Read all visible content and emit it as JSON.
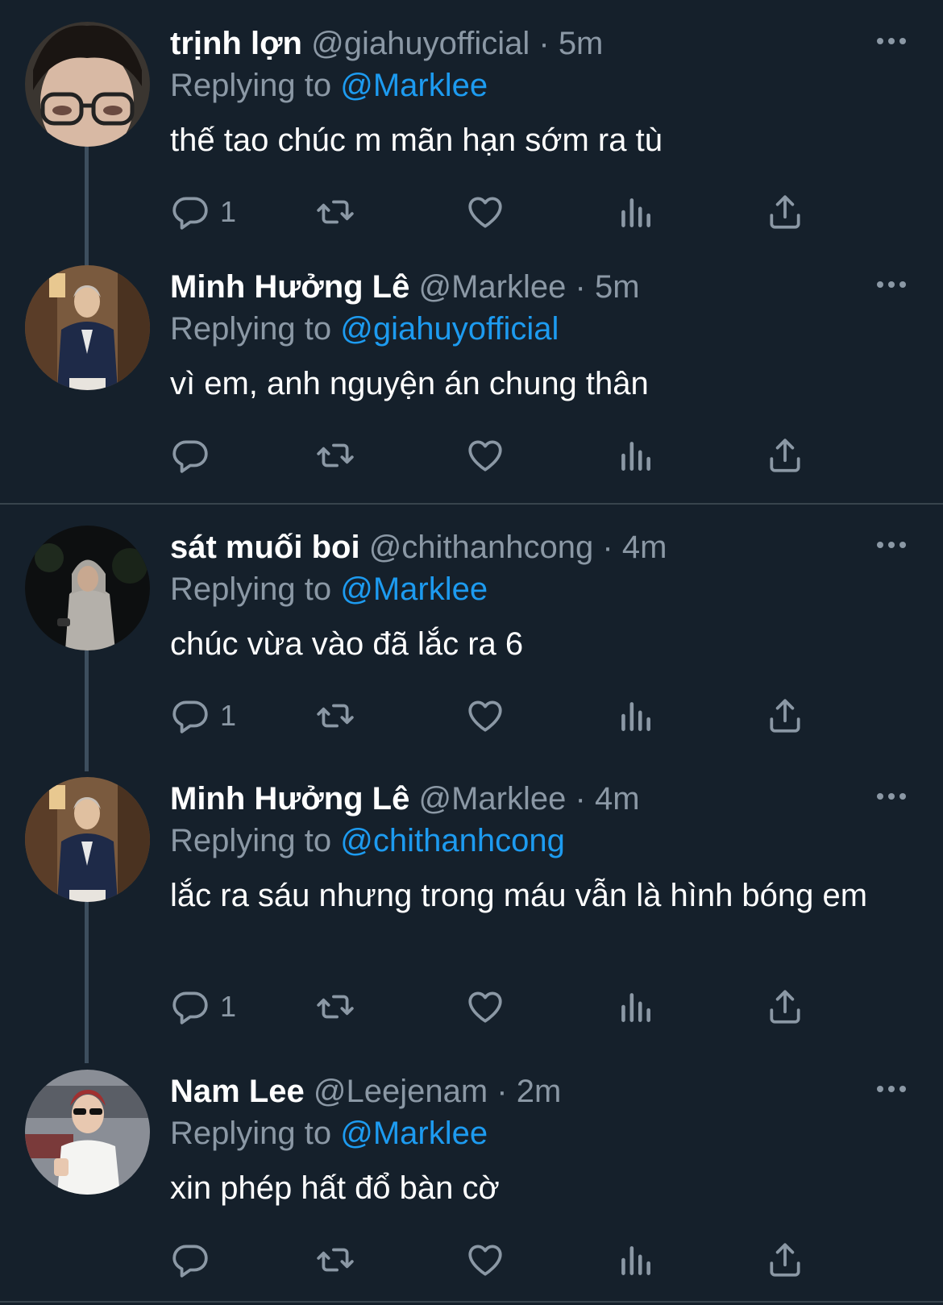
{
  "colors": {
    "background": "#15202b",
    "secondary_text": "#8b98a5",
    "mention": "#1d9bf0",
    "thread_line": "#3d4e5e",
    "divider": "#38444d"
  },
  "tweets": [
    {
      "name": "trịnh lợn",
      "handle": "@giahuyofficial",
      "separator": "·",
      "time": "5m",
      "replying_label": "Replying to",
      "replying_to": "@Marklee",
      "text": "thế tao chúc m mãn hạn sớm ra tù",
      "reply_count": "1"
    },
    {
      "name": "Minh Hưởng Lê",
      "handle": "@Marklee",
      "separator": "·",
      "time": "5m",
      "replying_label": "Replying to",
      "replying_to": "@giahuyofficial",
      "text": "vì em, anh nguyện án chung thân",
      "reply_count": ""
    },
    {
      "name": "sát muối boi",
      "handle": "@chithanhcong",
      "separator": "·",
      "time": "4m",
      "replying_label": "Replying to",
      "replying_to": "@Marklee",
      "text": "chúc vừa vào đã lắc ra 6",
      "reply_count": "1"
    },
    {
      "name": "Minh Hưởng Lê",
      "handle": "@Marklee",
      "separator": "·",
      "time": "4m",
      "replying_label": "Replying to",
      "replying_to": "@chithanhcong",
      "text": "lắc ra sáu nhưng trong máu vẫn là hình bóng em",
      "reply_count": "1"
    },
    {
      "name": "Nam Lee",
      "handle": "@Leejenam",
      "separator": "·",
      "time": "2m",
      "replying_label": "Replying to",
      "replying_to": "@Marklee",
      "text": "xin phép hất đổ bàn cờ",
      "reply_count": ""
    }
  ],
  "icons": {
    "reply": "reply-icon",
    "retweet": "retweet-icon",
    "like": "heart-icon",
    "views": "views-icon",
    "share": "share-icon",
    "more": "more-icon"
  }
}
